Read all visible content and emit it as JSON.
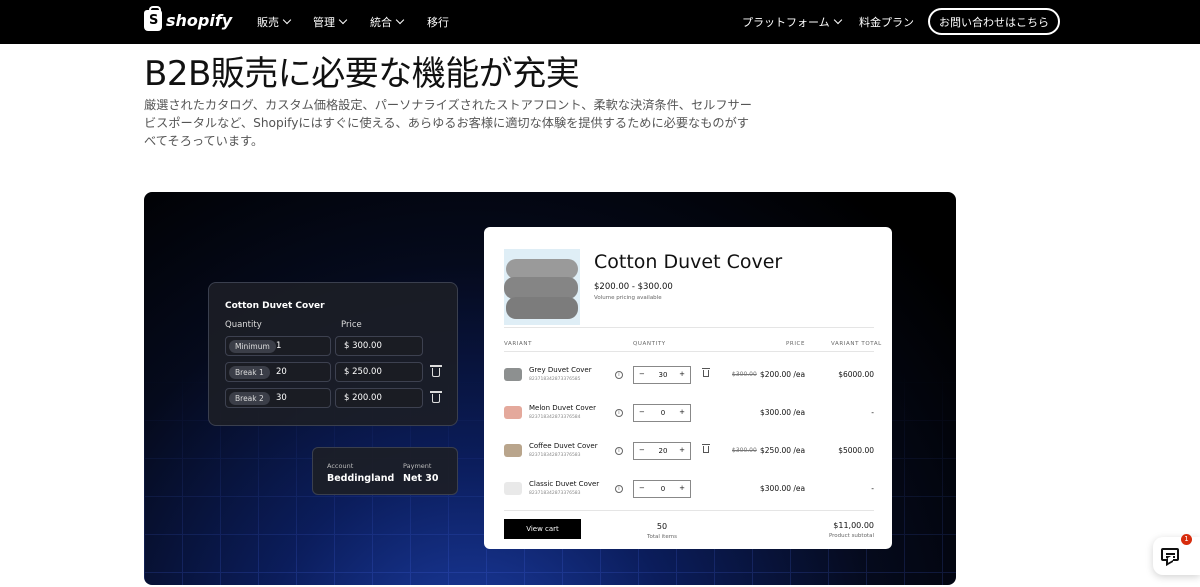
{
  "nav": {
    "logo_text": "shopify",
    "logo_letter": "S",
    "items": [
      {
        "label": "販売"
      },
      {
        "label": "管理"
      },
      {
        "label": "統合"
      },
      {
        "label": "移行"
      }
    ],
    "platform_label": "プラットフォーム",
    "pricing_label": "料金プラン",
    "contact_button": "お問い合わせはこちら"
  },
  "hero": {
    "title": "B2B販売に必要な機能が充実",
    "description": "厳選されたカタログ、カスタム価格設定、パーソナライズされたストアフロント、柔軟な決済条件、セルフサービスポータルなど、Shopifyにはすぐに使える、あらゆるお客様に適切な体験を提供するために必要なものがすべてそろっています。"
  },
  "price_card": {
    "title": "Cotton Duvet Cover",
    "quantity_header": "Quantity",
    "price_header": "Price",
    "rows": [
      {
        "tag": "Minimum",
        "qty": "1",
        "price": "$ 300.00"
      },
      {
        "tag": "Break 1",
        "qty": "20",
        "price": "$ 250.00"
      },
      {
        "tag": "Break 2",
        "qty": "30",
        "price": "$ 200.00"
      }
    ]
  },
  "account_card": {
    "account_label": "Account",
    "account_value": "Beddingland",
    "payment_label": "Payment",
    "payment_value": "Net 30"
  },
  "product": {
    "name": "Cotton Duvet Cover",
    "price_range": "$200.00 - $300.00",
    "volume_note": "Volume pricing available",
    "col_variant": "VARIANT",
    "col_quantity": "QUANTITY",
    "col_price": "PRICE",
    "col_total": "VARIANT TOTAL",
    "variants": [
      {
        "name": "Grey Duvet Cover",
        "sku": "823718342873376585",
        "qty": "30",
        "orig_price": "$300.00",
        "price": "$200.00 /ea",
        "total": "$6000.00",
        "thumb_color": "#8d9090"
      },
      {
        "name": "Melon Duvet Cover",
        "sku": "823718342873376584",
        "qty": "0",
        "orig_price": "",
        "price": "$300.00 /ea",
        "total": "-",
        "thumb_color": "#e4a99c"
      },
      {
        "name": "Coffee Duvet Cover",
        "sku": "823718342873376583",
        "qty": "20",
        "orig_price": "$300.00",
        "price": "$250.00 /ea",
        "total": "$5000.00",
        "thumb_color": "#b9a58c"
      },
      {
        "name": "Classic Duvet Cover",
        "sku": "823718342873376583",
        "qty": "0",
        "orig_price": "",
        "price": "$300.00 /ea",
        "total": "-",
        "thumb_color": "#e9e9e9"
      }
    ],
    "view_cart": "View cart",
    "total_items": "50",
    "total_items_label": "Total items",
    "subtotal": "$11,00.00",
    "subtotal_label": "Product subtotal"
  },
  "chat": {
    "badge_count": "1"
  },
  "colors": {
    "nav_bg": "#000000",
    "accent_blue": "#1d3fa8",
    "badge_red": "#d72c0d"
  }
}
